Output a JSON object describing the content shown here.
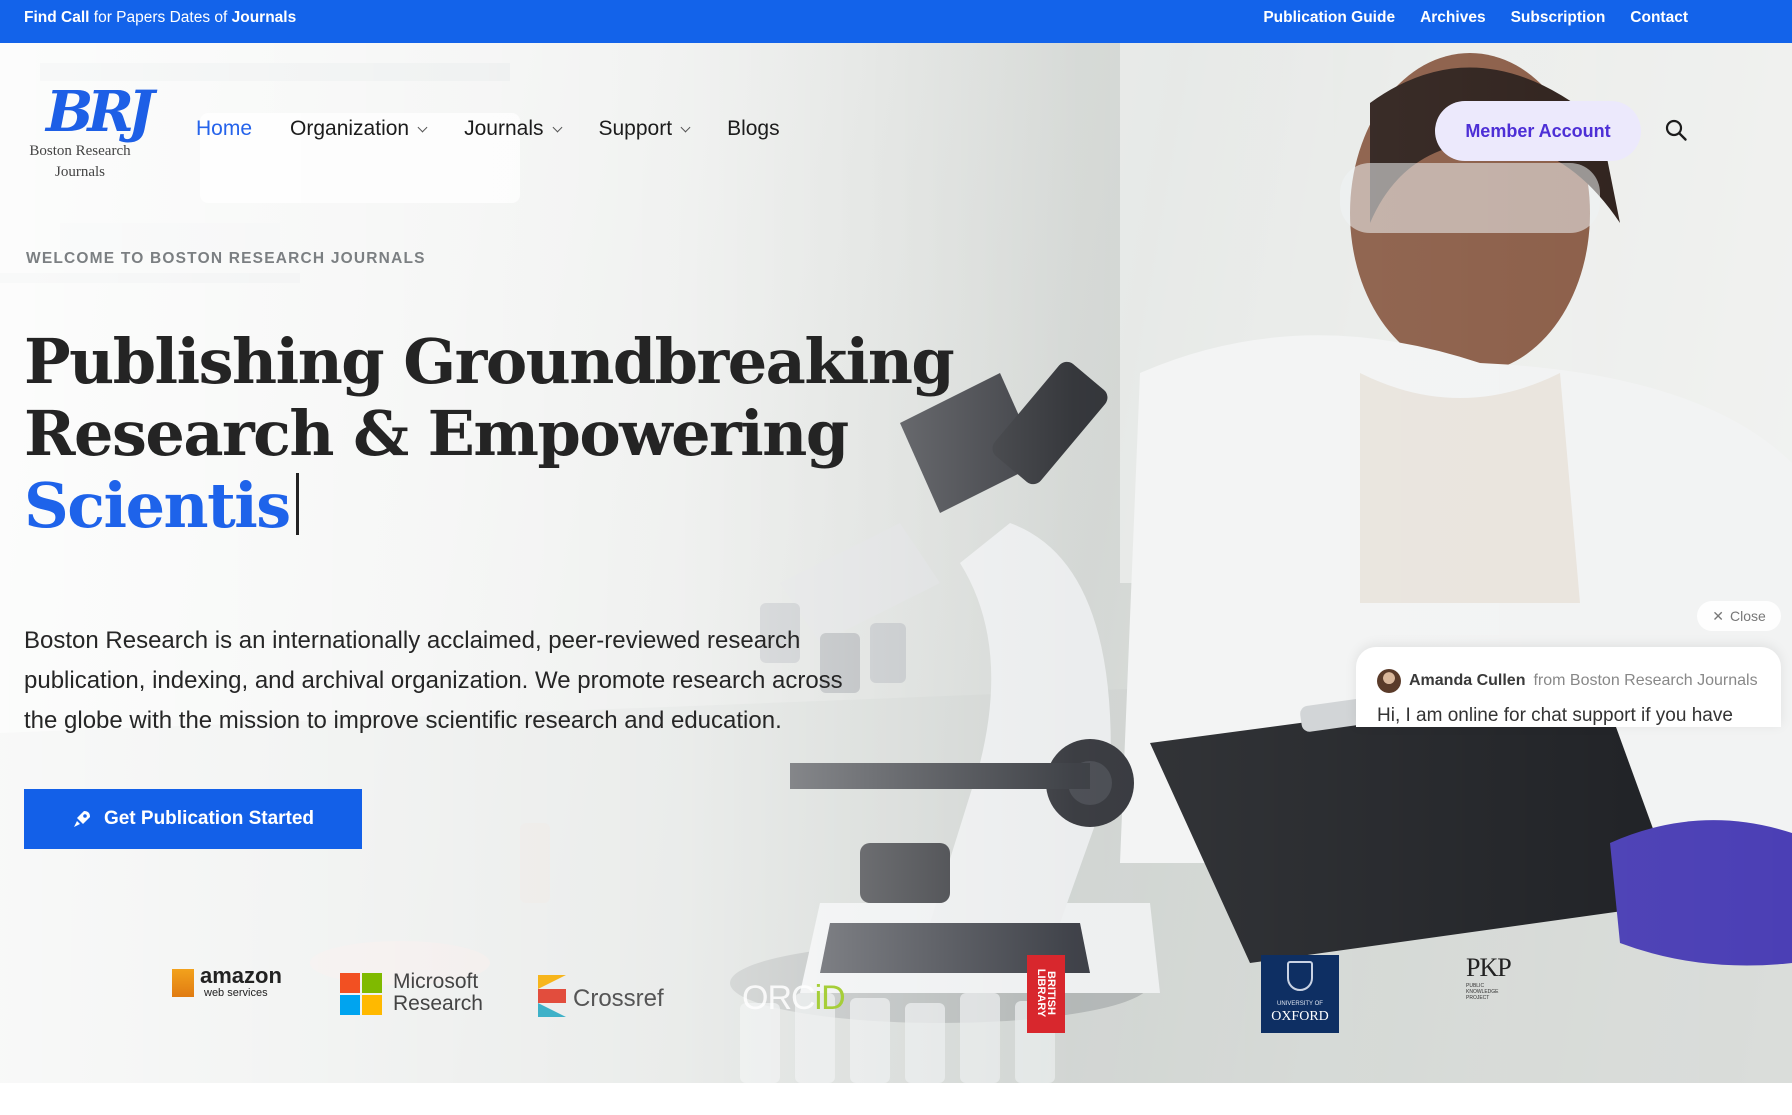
{
  "topbar": {
    "tagline_bold1": "Find Call",
    "tagline_mid": "for Papers Dates of",
    "tagline_bold2": "Journals",
    "links": [
      "Publication Guide",
      "Archives",
      "Subscription",
      "Contact"
    ]
  },
  "brand": {
    "mark": "BRJ",
    "name_line1": "Boston Research",
    "name_line2": "Journals"
  },
  "nav": {
    "items": [
      {
        "label": "Home",
        "active": true
      },
      {
        "label": "Organization",
        "dropdown": true
      },
      {
        "label": "Journals",
        "dropdown": true
      },
      {
        "label": "Support",
        "dropdown": true
      },
      {
        "label": "Blogs"
      }
    ],
    "member_button": "Member Account",
    "search_icon": "search-icon"
  },
  "hero": {
    "eyebrow": "WELCOME TO BOSTON RESEARCH JOURNALS",
    "headline_line1": "Publishing Groundbreaking",
    "headline_line2": "Research & Empowering",
    "headline_accent": "Scientis",
    "description": "Boston Research is an internationally acclaimed, peer-reviewed research publication, indexing, and archival organization. We promote research across the globe with the mission to improve scientific research and education.",
    "cta_label": "Get Publication Started",
    "cta_icon": "rocket-icon"
  },
  "partners": {
    "amazon_main": "amazon",
    "amazon_sub": "web services",
    "microsoft_line1": "Microsoft",
    "microsoft_line2": "Research",
    "crossref": "Crossref",
    "orcid_a": "ORC",
    "orcid_b": "iD",
    "british_line1": "BRITISH",
    "british_line2": "LIBRARY",
    "oxford_small": "UNIVERSITY OF",
    "oxford_main": "OXFORD",
    "pkp_main": "PKP",
    "pkp_line1": "PUBLIC",
    "pkp_line2": "KNOWLEDGE",
    "pkp_line3": "PROJECT"
  },
  "chat": {
    "close_label": "Close",
    "agent_name": "Amanda Cullen",
    "agent_from": "from Boston Research Journals",
    "message": "Hi, I am online for chat support if you have"
  },
  "colors": {
    "primary": "#1363ea",
    "accent_text": "#1e63ea",
    "member_bg": "#ece9fc",
    "member_text": "#4d2fd6"
  }
}
